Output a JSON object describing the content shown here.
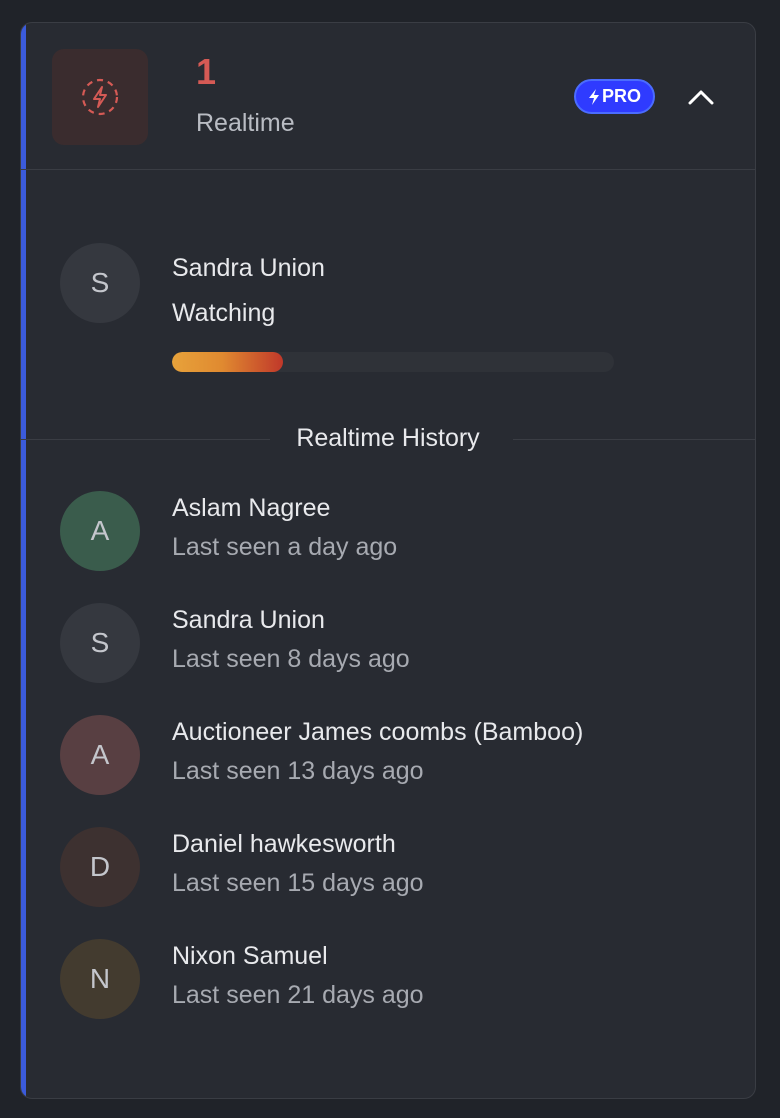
{
  "header": {
    "count": "1",
    "label": "Realtime",
    "badge": "PRO",
    "icon": "bolt-circle-icon",
    "collapse_icon": "chevron-up-icon"
  },
  "current": {
    "avatar_letter": "S",
    "name": "Sandra Union",
    "status": "Watching",
    "progress_fraction": 0.25
  },
  "history": {
    "title": "Realtime History",
    "items": [
      {
        "letter": "A",
        "name": "Aslam Nagree",
        "seen": "Last seen a day ago",
        "color": "#3a5c4c"
      },
      {
        "letter": "S",
        "name": "Sandra Union",
        "seen": "Last seen 8 days ago",
        "color": "#35383f"
      },
      {
        "letter": "A",
        "name": "Auctioneer James coombs (Bamboo)",
        "seen": "Last seen 13 days ago",
        "color": "#583f42"
      },
      {
        "letter": "D",
        "name": "Daniel hawkesworth",
        "seen": "Last seen 15 days ago",
        "color": "#3d3130"
      },
      {
        "letter": "N",
        "name": "Nixon Samuel",
        "seen": "Last seen 21 days ago",
        "color": "#433b2f"
      }
    ]
  },
  "colors": {
    "accent": "#3b5bdb",
    "count": "#d55a55",
    "badge": "#2f3bff",
    "progress_start": "#e7a23b",
    "progress_end": "#c0382a"
  }
}
